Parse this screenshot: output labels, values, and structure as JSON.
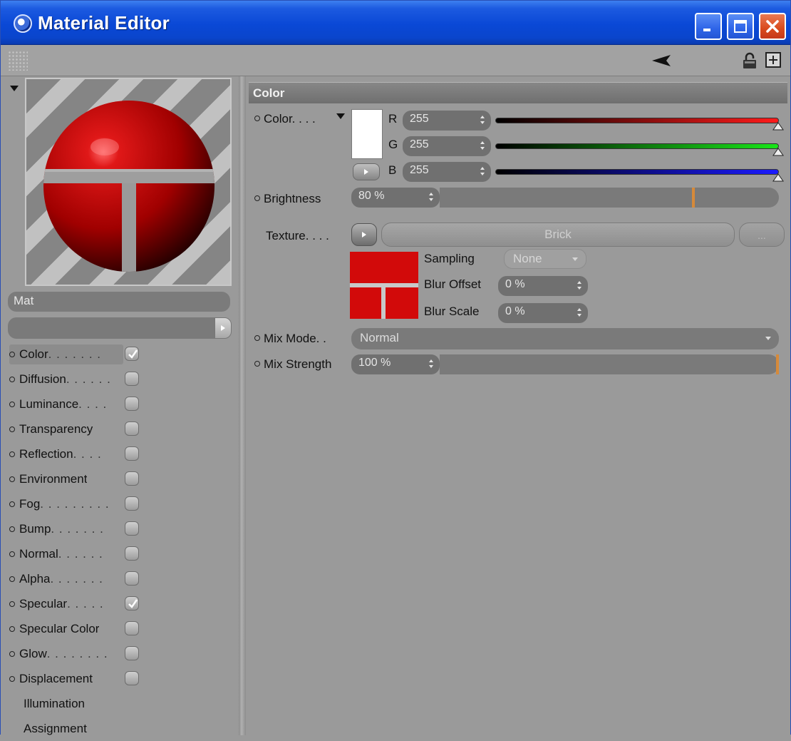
{
  "window": {
    "title": "Material Editor",
    "controls": {
      "minimize": "minimize-icon",
      "maximize": "maximize-icon",
      "close": "close-icon"
    }
  },
  "toolbar": {
    "icons": [
      "grip-icon",
      "back-arrow-icon",
      "lock-icon",
      "new-window-icon"
    ]
  },
  "material": {
    "name": "Mat"
  },
  "channels": [
    {
      "label": "Color",
      "dots": ". . . . . . .",
      "checked": true,
      "active": true,
      "has_dot": true
    },
    {
      "label": "Diffusion",
      "dots": ". . . . . .",
      "checked": false,
      "has_dot": true
    },
    {
      "label": "Luminance",
      "dots": ". . . .",
      "checked": false,
      "has_dot": true
    },
    {
      "label": "Transparency",
      "dots": "",
      "checked": false,
      "has_dot": true
    },
    {
      "label": "Reflection",
      "dots": ". . . .",
      "checked": false,
      "has_dot": true
    },
    {
      "label": "Environment",
      "dots": "",
      "checked": false,
      "has_dot": true
    },
    {
      "label": "Fog",
      "dots": ". . . . . . . . .",
      "checked": false,
      "has_dot": true
    },
    {
      "label": "Bump",
      "dots": ". . . . . . .",
      "checked": false,
      "has_dot": true
    },
    {
      "label": "Normal",
      "dots": ". . . . . .",
      "checked": false,
      "has_dot": true
    },
    {
      "label": "Alpha",
      "dots": ". . . . . . .",
      "checked": false,
      "has_dot": true
    },
    {
      "label": "Specular",
      "dots": ". . . . .",
      "checked": true,
      "has_dot": true
    },
    {
      "label": "Specular Color",
      "dots": "",
      "checked": false,
      "has_dot": true
    },
    {
      "label": "Glow",
      "dots": ". . . . . . . .",
      "checked": false,
      "has_dot": true
    },
    {
      "label": "Displacement",
      "dots": "",
      "checked": false,
      "has_dot": true
    },
    {
      "label": "Illumination",
      "has_dot": false
    },
    {
      "label": "Assignment",
      "has_dot": false
    }
  ],
  "color_section": {
    "header": "Color",
    "color_label": "Color. . . .",
    "swatch_color": "#ffffff",
    "r": {
      "letter": "R",
      "value": "255",
      "fraction": 1.0,
      "color": "#ff1a1a"
    },
    "g": {
      "letter": "G",
      "value": "255",
      "fraction": 1.0,
      "color": "#19e619"
    },
    "b": {
      "letter": "B",
      "value": "255",
      "fraction": 1.0,
      "color": "#1a1aff"
    },
    "brightness": {
      "label": "Brightness",
      "value": "80 %",
      "fraction": 0.8
    },
    "texture": {
      "label": "Texture. . . .",
      "name": "Brick",
      "more_label": "..."
    },
    "sampling": {
      "label": "Sampling",
      "value": "None"
    },
    "blur_offset": {
      "label": "Blur Offset",
      "value": "0 %"
    },
    "blur_scale": {
      "label": "Blur Scale",
      "value": "0 %"
    },
    "mix_mode": {
      "label": "Mix Mode. .",
      "value": "Normal"
    },
    "mix_strength": {
      "label": "Mix Strength",
      "value": "100 %",
      "fraction": 1.0
    }
  }
}
